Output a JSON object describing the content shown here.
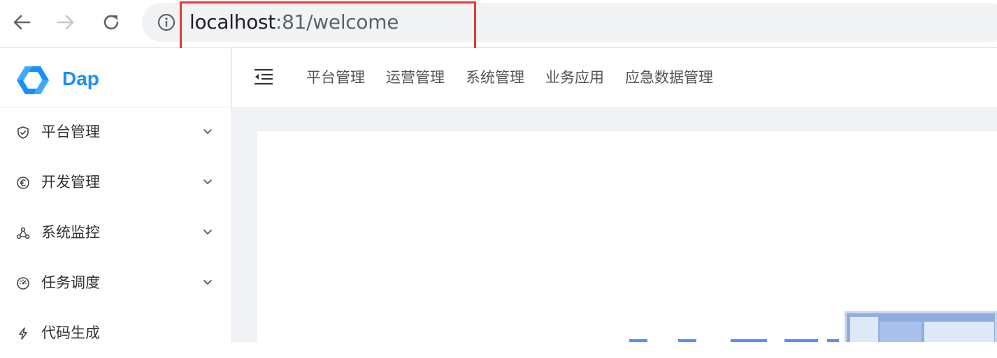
{
  "browser": {
    "url_host": "localhost",
    "url_path": ":81/welcome",
    "icons": {
      "back": "arrow-left-icon",
      "forward": "arrow-right-icon",
      "reload": "reload-icon",
      "info": "info-icon"
    }
  },
  "app": {
    "logo_text": "Dap",
    "accent_color": "#1890ff"
  },
  "sidebar": {
    "items": [
      {
        "label": "平台管理",
        "icon": "shield-check-icon",
        "has_submenu": true
      },
      {
        "label": "开发管理",
        "icon": "euro-circle-icon",
        "has_submenu": true
      },
      {
        "label": "系统监控",
        "icon": "cluster-icon",
        "has_submenu": true
      },
      {
        "label": "任务调度",
        "icon": "dashboard-gauge-icon",
        "has_submenu": true
      },
      {
        "label": "代码生成",
        "icon": "thunderbolt-icon",
        "has_submenu": false
      }
    ]
  },
  "header": {
    "collapse_icon": "menu-fold-icon",
    "nav": [
      {
        "label": "平台管理"
      },
      {
        "label": "运营管理"
      },
      {
        "label": "系统管理"
      },
      {
        "label": "业务应用"
      },
      {
        "label": "应急数据管理"
      }
    ]
  },
  "annotation": {
    "color": "#e53935"
  }
}
